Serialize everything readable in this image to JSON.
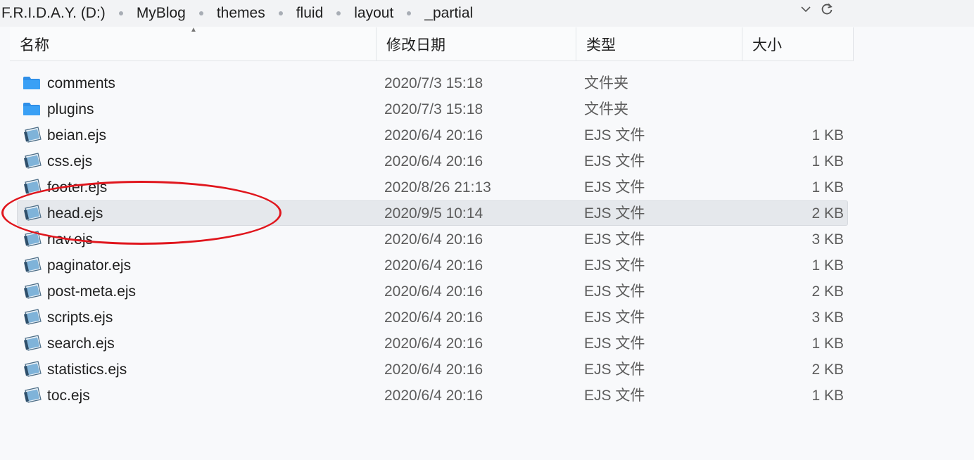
{
  "breadcrumb": [
    "F.R.I.D.A.Y. (D:)",
    "MyBlog",
    "themes",
    "fluid",
    "layout",
    "_partial"
  ],
  "columns": {
    "name": "名称",
    "date": "修改日期",
    "type": "类型",
    "size": "大小"
  },
  "files": [
    {
      "name": "comments",
      "date": "2020/7/3 15:18",
      "type": "文件夹",
      "size": "",
      "icon": "folder-icon"
    },
    {
      "name": "plugins",
      "date": "2020/7/3 15:18",
      "type": "文件夹",
      "size": "",
      "icon": "folder-icon"
    },
    {
      "name": "beian.ejs",
      "date": "2020/6/4 20:16",
      "type": "EJS 文件",
      "size": "1 KB",
      "icon": "ejs-file-icon"
    },
    {
      "name": "css.ejs",
      "date": "2020/6/4 20:16",
      "type": "EJS 文件",
      "size": "1 KB",
      "icon": "ejs-file-icon"
    },
    {
      "name": "footer.ejs",
      "date": "2020/8/26 21:13",
      "type": "EJS 文件",
      "size": "1 KB",
      "icon": "ejs-file-icon"
    },
    {
      "name": "head.ejs",
      "date": "2020/9/5 10:14",
      "type": "EJS 文件",
      "size": "2 KB",
      "icon": "ejs-file-icon",
      "selected": true
    },
    {
      "name": "nav.ejs",
      "date": "2020/6/4 20:16",
      "type": "EJS 文件",
      "size": "3 KB",
      "icon": "ejs-file-icon"
    },
    {
      "name": "paginator.ejs",
      "date": "2020/6/4 20:16",
      "type": "EJS 文件",
      "size": "1 KB",
      "icon": "ejs-file-icon"
    },
    {
      "name": "post-meta.ejs",
      "date": "2020/6/4 20:16",
      "type": "EJS 文件",
      "size": "2 KB",
      "icon": "ejs-file-icon"
    },
    {
      "name": "scripts.ejs",
      "date": "2020/6/4 20:16",
      "type": "EJS 文件",
      "size": "3 KB",
      "icon": "ejs-file-icon"
    },
    {
      "name": "search.ejs",
      "date": "2020/6/4 20:16",
      "type": "EJS 文件",
      "size": "1 KB",
      "icon": "ejs-file-icon"
    },
    {
      "name": "statistics.ejs",
      "date": "2020/6/4 20:16",
      "type": "EJS 文件",
      "size": "2 KB",
      "icon": "ejs-file-icon"
    },
    {
      "name": "toc.ejs",
      "date": "2020/6/4 20:16",
      "type": "EJS 文件",
      "size": "1 KB",
      "icon": "ejs-file-icon"
    }
  ],
  "colors": {
    "annotation": "#e0161d",
    "folder": "#2f8fe8",
    "selection": "#e5e8ec"
  }
}
